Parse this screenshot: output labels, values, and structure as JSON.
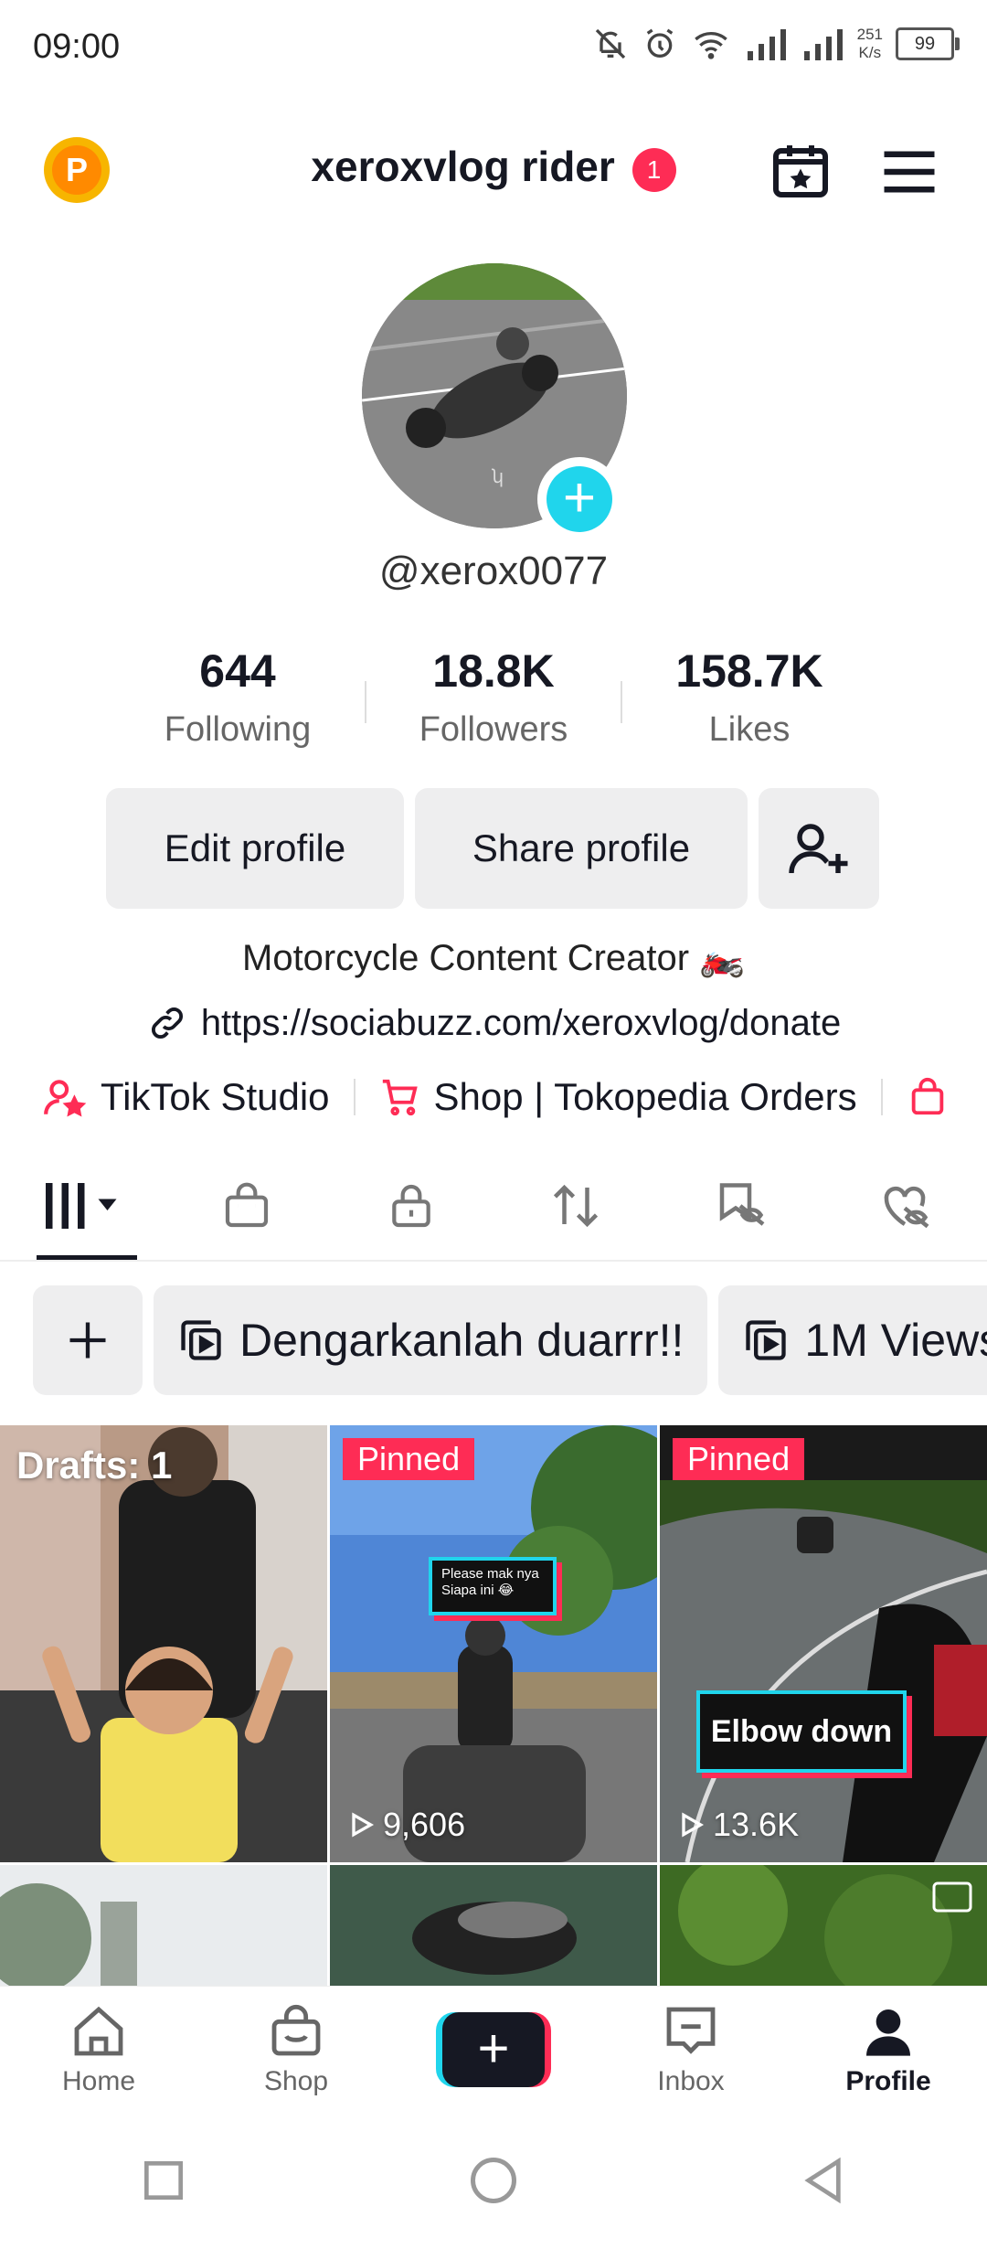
{
  "status_bar": {
    "time": "09:00",
    "net_speed_value": "251",
    "net_speed_unit": "K/s",
    "battery": "99"
  },
  "header": {
    "coin_letter": "P",
    "title": "xeroxvlog rider",
    "notification_count": "1"
  },
  "profile": {
    "handle": "@xerox0077"
  },
  "stats": [
    {
      "value": "644",
      "label": "Following"
    },
    {
      "value": "18.8K",
      "label": "Followers"
    },
    {
      "value": "158.7K",
      "label": "Likes"
    }
  ],
  "buttons": {
    "edit": "Edit profile",
    "share": "Share profile"
  },
  "bio": "Motorcycle Content Creator 🏍️",
  "link": "https://sociabuzz.com/xeroxvlog/donate",
  "shortcuts": [
    {
      "label": "TikTok Studio"
    },
    {
      "label": "Shop | Tokopedia Orders"
    }
  ],
  "playlists": [
    {
      "label": "Dengarkanlah duarrr!!"
    },
    {
      "label": "1M Views"
    }
  ],
  "videos": [
    {
      "overlay": "Drafts: 1"
    },
    {
      "badge": "Pinned",
      "caption_line1": "Please mak nya",
      "caption_line2": "Siapa ini 😂",
      "views": "9,606"
    },
    {
      "badge": "Pinned",
      "caption": "Elbow down",
      "views": "13.6K"
    }
  ],
  "bottom_nav": {
    "home": "Home",
    "shop": "Shop",
    "inbox": "Inbox",
    "profile": "Profile",
    "create": "+"
  },
  "colors": {
    "accent_red": "#fe2c55",
    "accent_cyan": "#20d5ec",
    "text": "#161823"
  }
}
